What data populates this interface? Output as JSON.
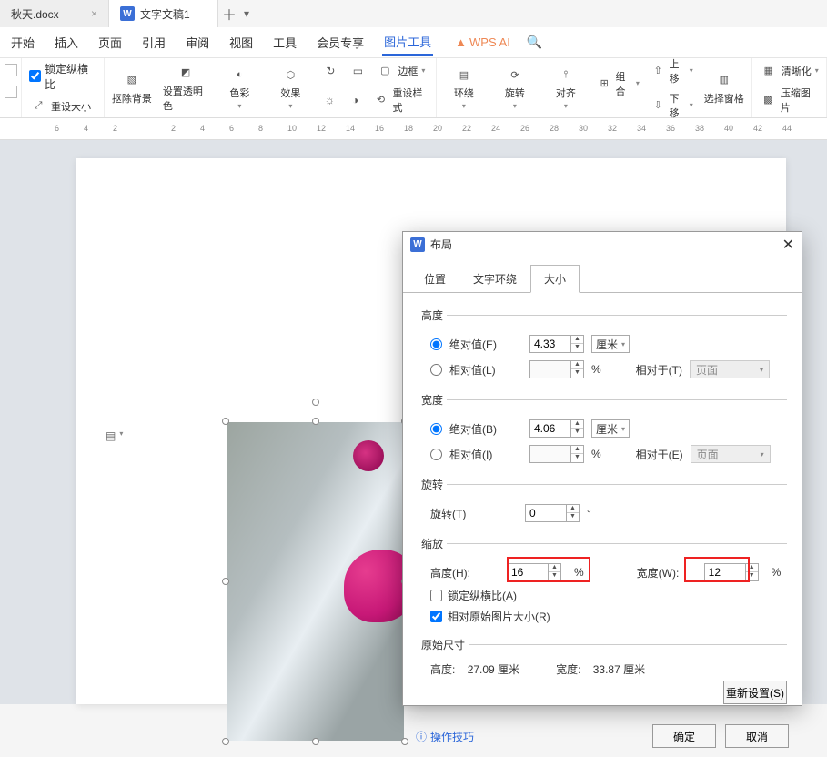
{
  "tabs": {
    "doc1": "秋天.docx",
    "doc2": "文字文稿1"
  },
  "menu": {
    "start": "开始",
    "insert": "插入",
    "page": "页面",
    "ref": "引用",
    "review": "审阅",
    "view": "视图",
    "tool": "工具",
    "member": "会员专享",
    "pic_tool": "图片工具",
    "ai": "WPS AI"
  },
  "toolbar": {
    "lock_ratio": "锁定纵横比",
    "reset_size": "重设大小",
    "remove_bg": "抠除背景",
    "set_transparent": "设置透明色",
    "color": "色彩",
    "effect": "效果",
    "border": "边框",
    "reset_style": "重设样式",
    "wrap": "环绕",
    "rotate": "旋转",
    "align": "对齐",
    "group": "组合",
    "up": "上移",
    "down": "下移",
    "select_pane": "选择窗格",
    "sharpen": "清晰化",
    "compress": "压缩图片"
  },
  "ruler": {
    "ticks": [
      "6",
      "4",
      "2",
      "",
      "2",
      "4",
      "6",
      "8",
      "10",
      "12",
      "14",
      "16",
      "18",
      "20",
      "22",
      "24",
      "26",
      "28",
      "30",
      "32",
      "34",
      "36",
      "38",
      "40",
      "42",
      "44"
    ]
  },
  "dialog": {
    "title": "布局",
    "tabs": {
      "pos": "位置",
      "wrap": "文字环绕",
      "size": "大小"
    },
    "height": {
      "legend": "高度",
      "abs_label": "绝对值(E)",
      "abs_value": "4.33",
      "unit": "厘米",
      "rel_label": "相对值(L)",
      "rel_value": "",
      "pct": "%",
      "relative_to_label": "相对于(T)",
      "relative_to_value": "页面"
    },
    "width": {
      "legend": "宽度",
      "abs_label": "绝对值(B)",
      "abs_value": "4.06",
      "unit": "厘米",
      "rel_label": "相对值(I)",
      "rel_value": "",
      "pct": "%",
      "relative_to_label": "相对于(E)",
      "relative_to_value": "页面"
    },
    "rotation": {
      "legend": "旋转",
      "label": "旋转(T)",
      "value": "0",
      "unit": "°"
    },
    "scale": {
      "legend": "缩放",
      "h_label": "高度(H):",
      "h_value": "16",
      "pct": "%",
      "w_label": "宽度(W):",
      "w_value": "12",
      "lock_label": "锁定纵横比(A)",
      "relative_orig_label": "相对原始图片大小(R)"
    },
    "original": {
      "legend": "原始尺寸",
      "h_label": "高度:",
      "h_value": "27.09 厘米",
      "w_label": "宽度:",
      "w_value": "33.87 厘米",
      "reset_btn": "重新设置(S)"
    },
    "tips": "操作技巧",
    "ok": "确定",
    "cancel": "取消"
  }
}
